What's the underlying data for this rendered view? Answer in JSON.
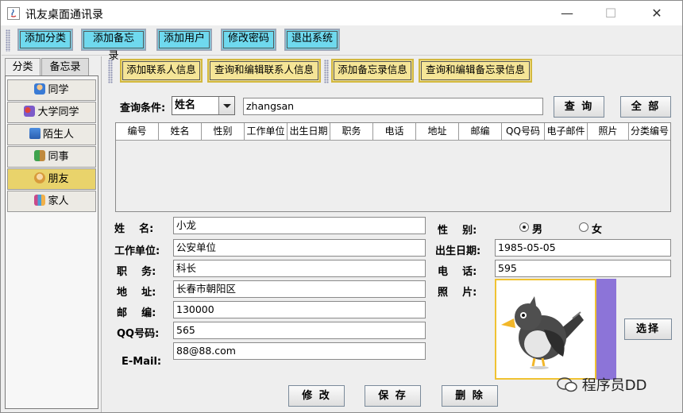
{
  "window": {
    "title": "讯友桌面通讯录",
    "minimize": "—",
    "maximize": "☐",
    "close": "✕"
  },
  "toolbar": [
    "添加分类",
    "添加备忘录",
    "添加用户",
    "修改密码",
    "退出系统"
  ],
  "left_tabs": [
    "分类",
    "备忘录"
  ],
  "categories": [
    "同学",
    "大学同学",
    "陌生人",
    "同事",
    "朋友",
    "家人"
  ],
  "selected_category": "朋友",
  "right_toolbar": [
    "添加联系人信息",
    "查询和编辑联系人信息",
    "添加备忘录信息",
    "查询和编辑备忘录信息"
  ],
  "query": {
    "label": "查询条件:",
    "field": "姓名",
    "value": "zhangsan",
    "search_button": "查 询",
    "all_button": "全 部"
  },
  "table": {
    "columns": [
      "编号",
      "姓名",
      "性别",
      "工作单位",
      "出生日期",
      "职务",
      "电话",
      "地址",
      "邮编",
      "QQ号码",
      "电子邮件",
      "照片",
      "分类编号"
    ]
  },
  "form": {
    "name_label": "姓    名:",
    "name": "小龙",
    "work_label": "工作单位:",
    "work": "公安单位",
    "position_label": "职    务:",
    "position": "科长",
    "address_label": "地    址:",
    "address": "长春市朝阳区",
    "zip_label": "邮    编:",
    "zip": "130000",
    "qq_label": "QQ号码:",
    "qq": "565",
    "email_label": "E-Mail:",
    "email": "88@88.com",
    "gender_label": "性    别:",
    "gender_male": "男",
    "gender_female": "女",
    "gender_selected": "男",
    "birth_label": "出生日期:",
    "birth": "1985-05-05",
    "phone_label": "电    话:",
    "phone": "595",
    "photo_label": "照    片:",
    "select_button": "选择"
  },
  "actions": [
    "修 改",
    "保 存",
    "删 除"
  ],
  "watermark": "程序员DD"
}
